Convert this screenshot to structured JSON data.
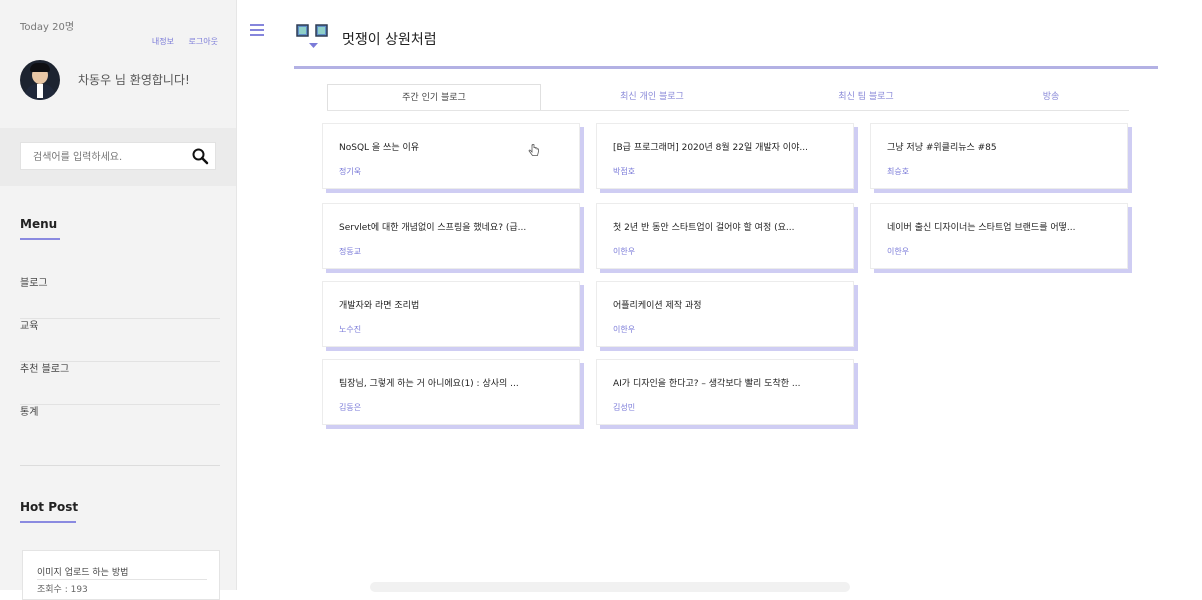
{
  "sidebar": {
    "today": "Today 20명",
    "links": {
      "my_info": "내정보",
      "logout": "로그아웃"
    },
    "welcome": "차동우 님 환영합니다!",
    "search_placeholder": "검색어를 입력하세요.",
    "menu_title": "Menu",
    "menu_items": [
      {
        "label": "블로그"
      },
      {
        "label": "교육"
      },
      {
        "label": "추천 블로그"
      },
      {
        "label": "통계"
      }
    ],
    "hot_title": "Hot Post",
    "hot_post": {
      "title": "이미지 업로드 하는 방법",
      "views": "조회수 : 193"
    }
  },
  "header": {
    "site_title": "멋쟁이 상원처럼"
  },
  "tabs": [
    {
      "label": "주간 인기 블로그"
    },
    {
      "label": "최신 개인 블로그"
    },
    {
      "label": "최신 팀 블로그"
    },
    {
      "label": "방송"
    }
  ],
  "posts": [
    {
      "title": "NoSQL 을 쓰는 이유",
      "author": "정기욱"
    },
    {
      "title": "[B급 프로그래머] 2020년 8월 22일 개발자 이야...",
      "author": "박점호"
    },
    {
      "title": "그냥 저냥 #위클리뉴스 #85",
      "author": "최승호"
    },
    {
      "title": "Servlet에 대한 개념없이 스프링을 했네요? (급...",
      "author": "정동교"
    },
    {
      "title": "첫 2년 반 동안 스타트업이 걸어야 할 여정 (요...",
      "author": "이한우"
    },
    {
      "title": "네이버 출신 디자이너는 스타트업 브랜드를 어떻...",
      "author": "이한우"
    },
    {
      "title": "개발자와 라면 조리법",
      "author": "노수진"
    },
    {
      "title": "어플리케이션 제작 과정",
      "author": "이한우"
    },
    {
      "title": "팀장님, 그렇게 하는 거 아니에요(1) : 상사의 ...",
      "author": "김동은"
    },
    {
      "title": "AI가 디자인을 한다고? – 생각보다 빨리 도착한 ...",
      "author": "김성민"
    }
  ],
  "colors": {
    "accent": "#8a8ae0",
    "card_shadow": "#cfcdf3",
    "header_line": "#b3b1e4"
  }
}
